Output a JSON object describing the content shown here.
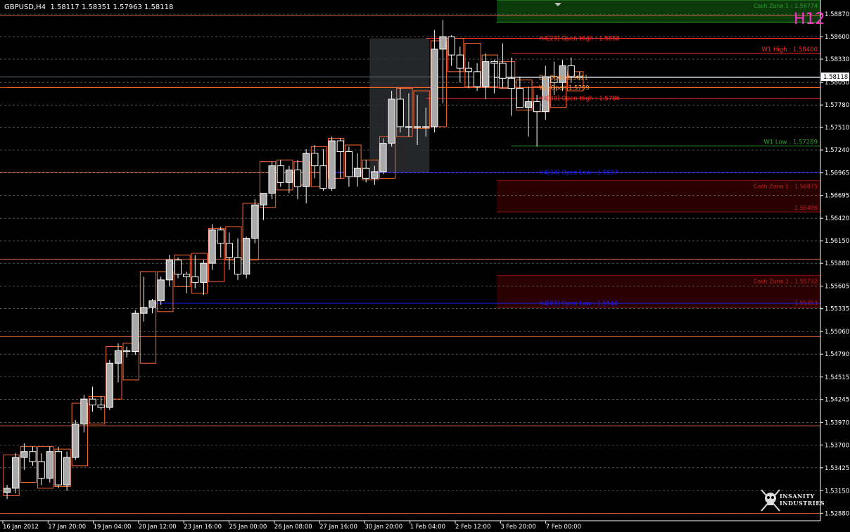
{
  "header": {
    "symbol": "GBPUSD,H4",
    "ohlc": "1.58117 1.58351 1.57963 1.58118"
  },
  "watermark": "H12",
  "current_price_label": "1.58118",
  "brand": {
    "line1": "INSANITY",
    "line2": "INDUSTRIES",
    "icon": "skull-crossbones-icon"
  },
  "colors": {
    "background": "#000000",
    "bull_body": "#a9a9a9",
    "bear_body": "#000000",
    "candle_wick": "#ffffff",
    "h12_candle": "#ff6633",
    "grid": "#8a8a8a",
    "zone_green": "#0b3a0b",
    "zone_red": "#2a0000",
    "level_red": "#ff2a2a",
    "level_blue": "#1e1eff",
    "level_orange": "#ff7744",
    "level_green": "#2f9e2f",
    "watermark": "#ff33cc"
  },
  "chart_data": {
    "type": "candlestick",
    "ylim": [
      1.5279,
      1.5904
    ],
    "y_ticks": [
      "1.58870",
      "1.58600",
      "1.58330",
      "1.58050",
      "1.57780",
      "1.57510",
      "1.57240",
      "1.56965",
      "1.56695",
      "1.56420",
      "1.56150",
      "1.55880",
      "1.55605",
      "1.55335",
      "1.55060",
      "1.54790",
      "1.54515",
      "1.54245",
      "1.53970",
      "1.53700",
      "1.53425",
      "1.53150",
      "1.52880"
    ],
    "x_labels": [
      "16 Jan 2012",
      "17 Jan 20:00",
      "19 Jan 04:00",
      "20 Jan 12:00",
      "23 Jan 16:00",
      "25 Jan 00:00",
      "26 Jan 08:00",
      "27 Jan 16:00",
      "30 Jan 20:00",
      "1 Feb 04:00",
      "2 Feb 12:00",
      "3 Feb 20:00",
      "7 Feb 00:00"
    ],
    "bar_count": 96,
    "candles": [
      [
        1.5313,
        1.5322,
        1.5305,
        1.5318
      ],
      [
        1.5318,
        1.536,
        1.5312,
        1.5355
      ],
      [
        1.5355,
        1.5372,
        1.534,
        1.5362
      ],
      [
        1.5362,
        1.5368,
        1.5345,
        1.535
      ],
      [
        1.535,
        1.536,
        1.5322,
        1.533
      ],
      [
        1.533,
        1.5368,
        1.5325,
        1.5362
      ],
      [
        1.5362,
        1.5368,
        1.5318,
        1.5322
      ],
      [
        1.5322,
        1.5362,
        1.5315,
        1.5355
      ],
      [
        1.5355,
        1.54,
        1.5352,
        1.5395
      ],
      [
        1.5395,
        1.543,
        1.5385,
        1.5425
      ],
      [
        1.5425,
        1.544,
        1.541,
        1.5418
      ],
      [
        1.5418,
        1.5428,
        1.5412,
        1.5415
      ],
      [
        1.5415,
        1.5472,
        1.5412,
        1.5468
      ],
      [
        1.5468,
        1.5492,
        1.5445,
        1.5483
      ],
      [
        1.5483,
        1.5488,
        1.5475,
        1.5482
      ],
      [
        1.5482,
        1.5532,
        1.5478,
        1.5528
      ],
      [
        1.5528,
        1.5572,
        1.5518,
        1.5535
      ],
      [
        1.5535,
        1.5545,
        1.5528,
        1.5543
      ],
      [
        1.5543,
        1.5572,
        1.5538,
        1.5568
      ],
      [
        1.5568,
        1.5598,
        1.556,
        1.5592
      ],
      [
        1.5592,
        1.5595,
        1.557,
        1.5575
      ],
      [
        1.5575,
        1.5578,
        1.5552,
        1.5572
      ],
      [
        1.5572,
        1.5598,
        1.5558,
        1.5565
      ],
      [
        1.5565,
        1.5592,
        1.555,
        1.5588
      ],
      [
        1.5588,
        1.5635,
        1.558,
        1.5628
      ],
      [
        1.5628,
        1.5632,
        1.5595,
        1.5612
      ],
      [
        1.5612,
        1.5625,
        1.558,
        1.5595
      ],
      [
        1.5595,
        1.5618,
        1.5568,
        1.5575
      ],
      [
        1.5575,
        1.562,
        1.557,
        1.5618
      ],
      [
        1.5618,
        1.5665,
        1.5612,
        1.5658
      ],
      [
        1.5658,
        1.5672,
        1.564,
        1.5672
      ],
      [
        1.5672,
        1.571,
        1.5665,
        1.5705
      ],
      [
        1.5705,
        1.5712,
        1.568,
        1.5685
      ],
      [
        1.5685,
        1.5705,
        1.5672,
        1.57
      ],
      [
        1.57,
        1.5712,
        1.5665,
        1.568
      ],
      [
        1.568,
        1.5725,
        1.566,
        1.572
      ],
      [
        1.572,
        1.573,
        1.569,
        1.5705
      ],
      [
        1.5705,
        1.5725,
        1.5675,
        1.5678
      ],
      [
        1.5678,
        1.574,
        1.5675,
        1.5735
      ],
      [
        1.5735,
        1.5738,
        1.569,
        1.5722
      ],
      [
        1.5722,
        1.5728,
        1.568,
        1.5692
      ],
      [
        1.5692,
        1.572,
        1.568,
        1.5702
      ],
      [
        1.5702,
        1.5712,
        1.5685,
        1.569
      ],
      [
        1.569,
        1.5705,
        1.5682,
        1.5698
      ],
      [
        1.5698,
        1.5738,
        1.5695,
        1.5732
      ],
      [
        1.5732,
        1.5795,
        1.5728,
        1.5785
      ],
      [
        1.5785,
        1.5798,
        1.5745,
        1.5752
      ],
      [
        1.5752,
        1.5792,
        1.574,
        1.5752
      ],
      [
        1.5752,
        1.579,
        1.573,
        1.5752
      ],
      [
        1.5752,
        1.5775,
        1.574,
        1.5752
      ],
      [
        1.5752,
        1.5868,
        1.5745,
        1.5845
      ],
      [
        1.5845,
        1.588,
        1.578,
        1.586
      ],
      [
        1.586,
        1.5862,
        1.5825,
        1.5838
      ],
      [
        1.5838,
        1.5848,
        1.5805,
        1.5822
      ],
      [
        1.5822,
        1.583,
        1.5798,
        1.5818
      ],
      [
        1.5818,
        1.5828,
        1.5795,
        1.58
      ],
      [
        1.58,
        1.584,
        1.5785,
        1.583
      ],
      [
        1.583,
        1.5832,
        1.5792,
        1.5828
      ],
      [
        1.5828,
        1.5852,
        1.5798,
        1.581
      ],
      [
        1.581,
        1.5835,
        1.5765,
        1.5798
      ],
      [
        1.5798,
        1.5812,
        1.5775,
        1.5775
      ],
      [
        1.5775,
        1.58,
        1.574,
        1.5782
      ],
      [
        1.5782,
        1.579,
        1.5728,
        1.577
      ],
      [
        1.577,
        1.5825,
        1.576,
        1.5812
      ],
      [
        1.5812,
        1.583,
        1.579,
        1.5805
      ],
      [
        1.5805,
        1.5832,
        1.5795,
        1.5825
      ],
      [
        1.5825,
        1.5835,
        1.5805,
        1.5812
      ],
      [
        1.5812,
        1.5818,
        1.5808,
        1.5812
      ]
    ],
    "h12_candles": [
      [
        0,
        1.5309,
        1.5358
      ],
      [
        2,
        1.5325,
        1.5368
      ],
      [
        4,
        1.5318,
        1.5368
      ],
      [
        6,
        1.532,
        1.5365
      ],
      [
        8,
        1.5345,
        1.542
      ],
      [
        10,
        1.5395,
        1.5428
      ],
      [
        12,
        1.5425,
        1.5488
      ],
      [
        14,
        1.5448,
        1.5492
      ],
      [
        16,
        1.5468,
        1.5578
      ],
      [
        18,
        1.553,
        1.5578
      ],
      [
        20,
        1.556,
        1.5598
      ],
      [
        22,
        1.5552,
        1.56
      ],
      [
        24,
        1.5566,
        1.563
      ],
      [
        26,
        1.5592,
        1.5632
      ],
      [
        28,
        1.5592,
        1.566
      ],
      [
        30,
        1.5655,
        1.571
      ],
      [
        32,
        1.5676,
        1.5712
      ],
      [
        34,
        1.5682,
        1.571
      ],
      [
        36,
        1.568,
        1.5728
      ],
      [
        38,
        1.569,
        1.5738
      ],
      [
        40,
        1.5692,
        1.573
      ],
      [
        42,
        1.5688,
        1.5712
      ],
      [
        44,
        1.569,
        1.574
      ],
      [
        46,
        1.574,
        1.5798
      ],
      [
        48,
        1.575,
        1.5795
      ],
      [
        50,
        1.5752,
        1.5855
      ],
      [
        52,
        1.5818,
        1.5858
      ],
      [
        54,
        1.58,
        1.5852
      ],
      [
        56,
        1.58,
        1.5838
      ],
      [
        58,
        1.5798,
        1.583
      ],
      [
        60,
        1.5772,
        1.5808
      ],
      [
        62,
        1.577,
        1.58
      ],
      [
        64,
        1.5775,
        1.5812
      ],
      [
        66,
        1.5795,
        1.5818
      ]
    ],
    "levels": [
      {
        "label": "H4[23] Open High : 1.5858",
        "value": 1.5858,
        "color": "#ff2a2a",
        "from_bar": 49
      },
      {
        "label": "W1 High : 1.58400",
        "value": 1.584,
        "color": "#ff2a2a",
        "from_bar": 59,
        "label_right": true
      },
      {
        "label": "D1 Open 1.5811",
        "value": 1.5811,
        "color": "#ffffff",
        "from_bar": 57,
        "label_color": "#ff9933"
      },
      {
        "label": "W1 Open 1.5799",
        "value": 1.5799,
        "color": "#ff6633",
        "from_bar": 0,
        "label_color": "#ff9933"
      },
      {
        "label": "H4[30] Open High : 1.5786",
        "value": 1.5786,
        "color": "#ff2a2a",
        "from_bar": 49
      },
      {
        "label": "W1 Low : 1.57289",
        "value": 1.57289,
        "color": "#2f9e2f",
        "from_bar": 59,
        "label_right": true
      },
      {
        "label": "H4[34] Open Low : 1.5697",
        "value": 1.5697,
        "color": "#1e1eff",
        "from_bar": 37
      },
      {
        "label": "H4[83] Open Low : 1.5540",
        "value": 1.554,
        "color": "#1e1eff",
        "from_bar": 17
      }
    ],
    "zones": [
      {
        "label_top": "Cash Zone 1 : 1.58774",
        "label_bottom": "",
        "top": 1.5904,
        "bottom": 1.58774,
        "color": "#0b3a0b",
        "line": "#2f9e2f"
      },
      {
        "label_top": "Cash Zone 1 : 1.56875",
        "label_bottom": "1.56496",
        "top": 1.56875,
        "bottom": 1.56496,
        "color": "#2a0000",
        "line": "#8a1010"
      },
      {
        "label_top": "Cash Zone 2 : 1.55732",
        "label_bottom": "1.55353",
        "top": 1.55732,
        "bottom": 1.55353,
        "color": "#2a0000",
        "line": "#8a1010"
      }
    ],
    "orange_lines": [
      1.5885,
      1.5799,
      1.5697,
      1.5593,
      1.55,
      1.5393,
      1.5288
    ],
    "highlight_region": {
      "from_bar": 43,
      "to_bar": 50,
      "top": 1.5858,
      "bottom": 1.5697
    },
    "price_line": 1.58118
  }
}
